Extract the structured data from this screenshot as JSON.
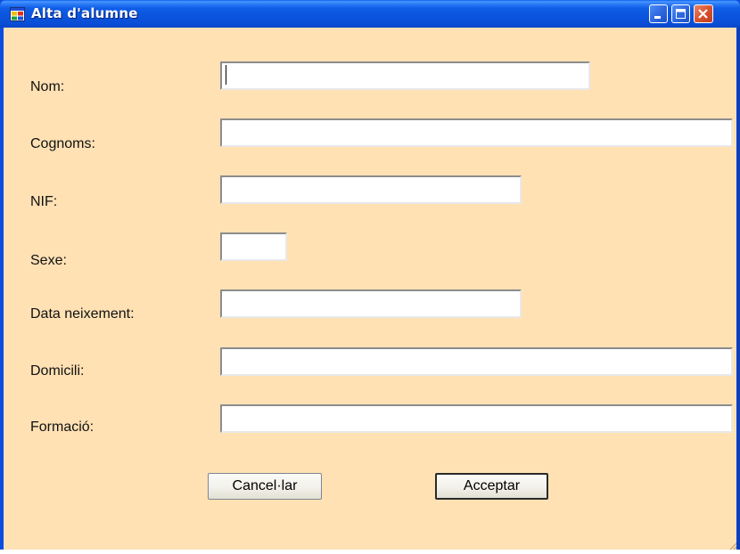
{
  "window": {
    "title": "Alta d'alumne",
    "app_icon": "windows-form-icon",
    "controls": [
      "minimize-icon",
      "maximize-icon",
      "close-icon"
    ]
  },
  "form": {
    "fields": [
      {
        "key": "nom",
        "label": "Nom:",
        "value": ""
      },
      {
        "key": "cognoms",
        "label": "Cognoms:",
        "value": ""
      },
      {
        "key": "nif",
        "label": "NIF:",
        "value": ""
      },
      {
        "key": "sexe",
        "label": "Sexe:",
        "value": ""
      },
      {
        "key": "data_neixement",
        "label": "Data neixement:",
        "value": ""
      },
      {
        "key": "domicili",
        "label": "Domicili:",
        "value": ""
      },
      {
        "key": "formacio",
        "label": "Formació:",
        "value": ""
      }
    ],
    "focused_field": "nom"
  },
  "buttons": {
    "cancel_label": "Cancel·lar",
    "accept_label": "Acceptar"
  },
  "colors": {
    "titlebar": "#0a4ee0",
    "client_background": "#ffe1b4",
    "close_button": "#d9532f"
  }
}
